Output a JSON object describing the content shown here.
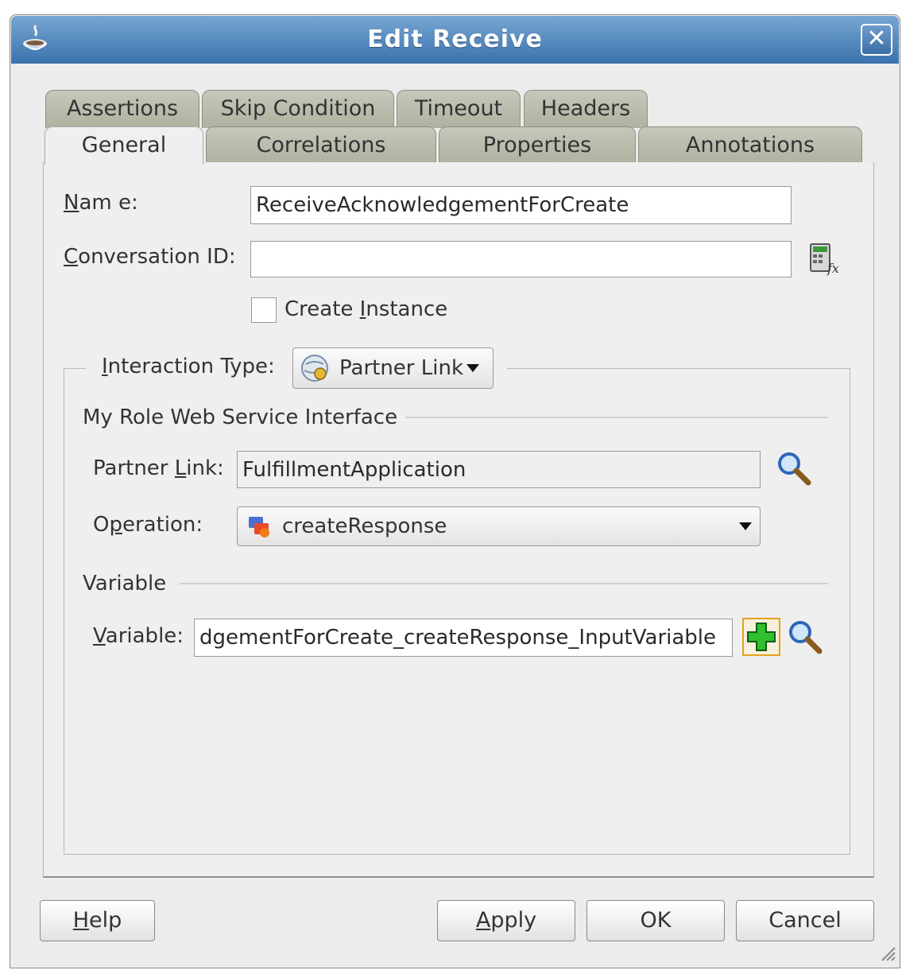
{
  "window": {
    "title": "Edit Receive",
    "close_icon": "close-icon"
  },
  "tabs_row1": [
    "Assertions",
    "Skip Condition",
    "Timeout",
    "Headers"
  ],
  "tabs_row2": [
    "General",
    "Correlations",
    "Properties",
    "Annotations"
  ],
  "active_tab": "General",
  "form": {
    "name_label_ul": "N",
    "name_label_rest": "am e:",
    "name_value": "ReceiveAcknowledgementForCreate",
    "conv_label_ul": "C",
    "conv_label_rest": "onversation ID:",
    "conv_value": "",
    "create_instance_pre": "Create ",
    "create_instance_ul": "I",
    "create_instance_rest": "nstance",
    "create_instance_checked": false
  },
  "interaction": {
    "label_ul": "I",
    "label_rest": "nteraction Type:",
    "selected": "Partner Link"
  },
  "role_section": {
    "title": "My Role Web Service Interface",
    "partner_link_label_pre": "Partner ",
    "partner_link_label_ul": "L",
    "partner_link_label_rest": "ink:",
    "partner_link_value": "FulfillmentApplication",
    "operation_label_pre": "O",
    "operation_label_ul": "p",
    "operation_label_rest": "eration:",
    "operation_value": "createResponse"
  },
  "variable_section": {
    "title": "Variable",
    "label_ul": "V",
    "label_rest": "ariable:",
    "value": "dgementForCreate_createResponse_InputVariable"
  },
  "buttons": {
    "help_ul": "H",
    "help_rest": "elp",
    "apply_ul": "A",
    "apply_rest": "pply",
    "ok": "OK",
    "cancel": "Cancel"
  },
  "colors": {
    "titlebar": "#3b72ad",
    "tab": "#b5b8a6",
    "panel": "#efefef"
  }
}
